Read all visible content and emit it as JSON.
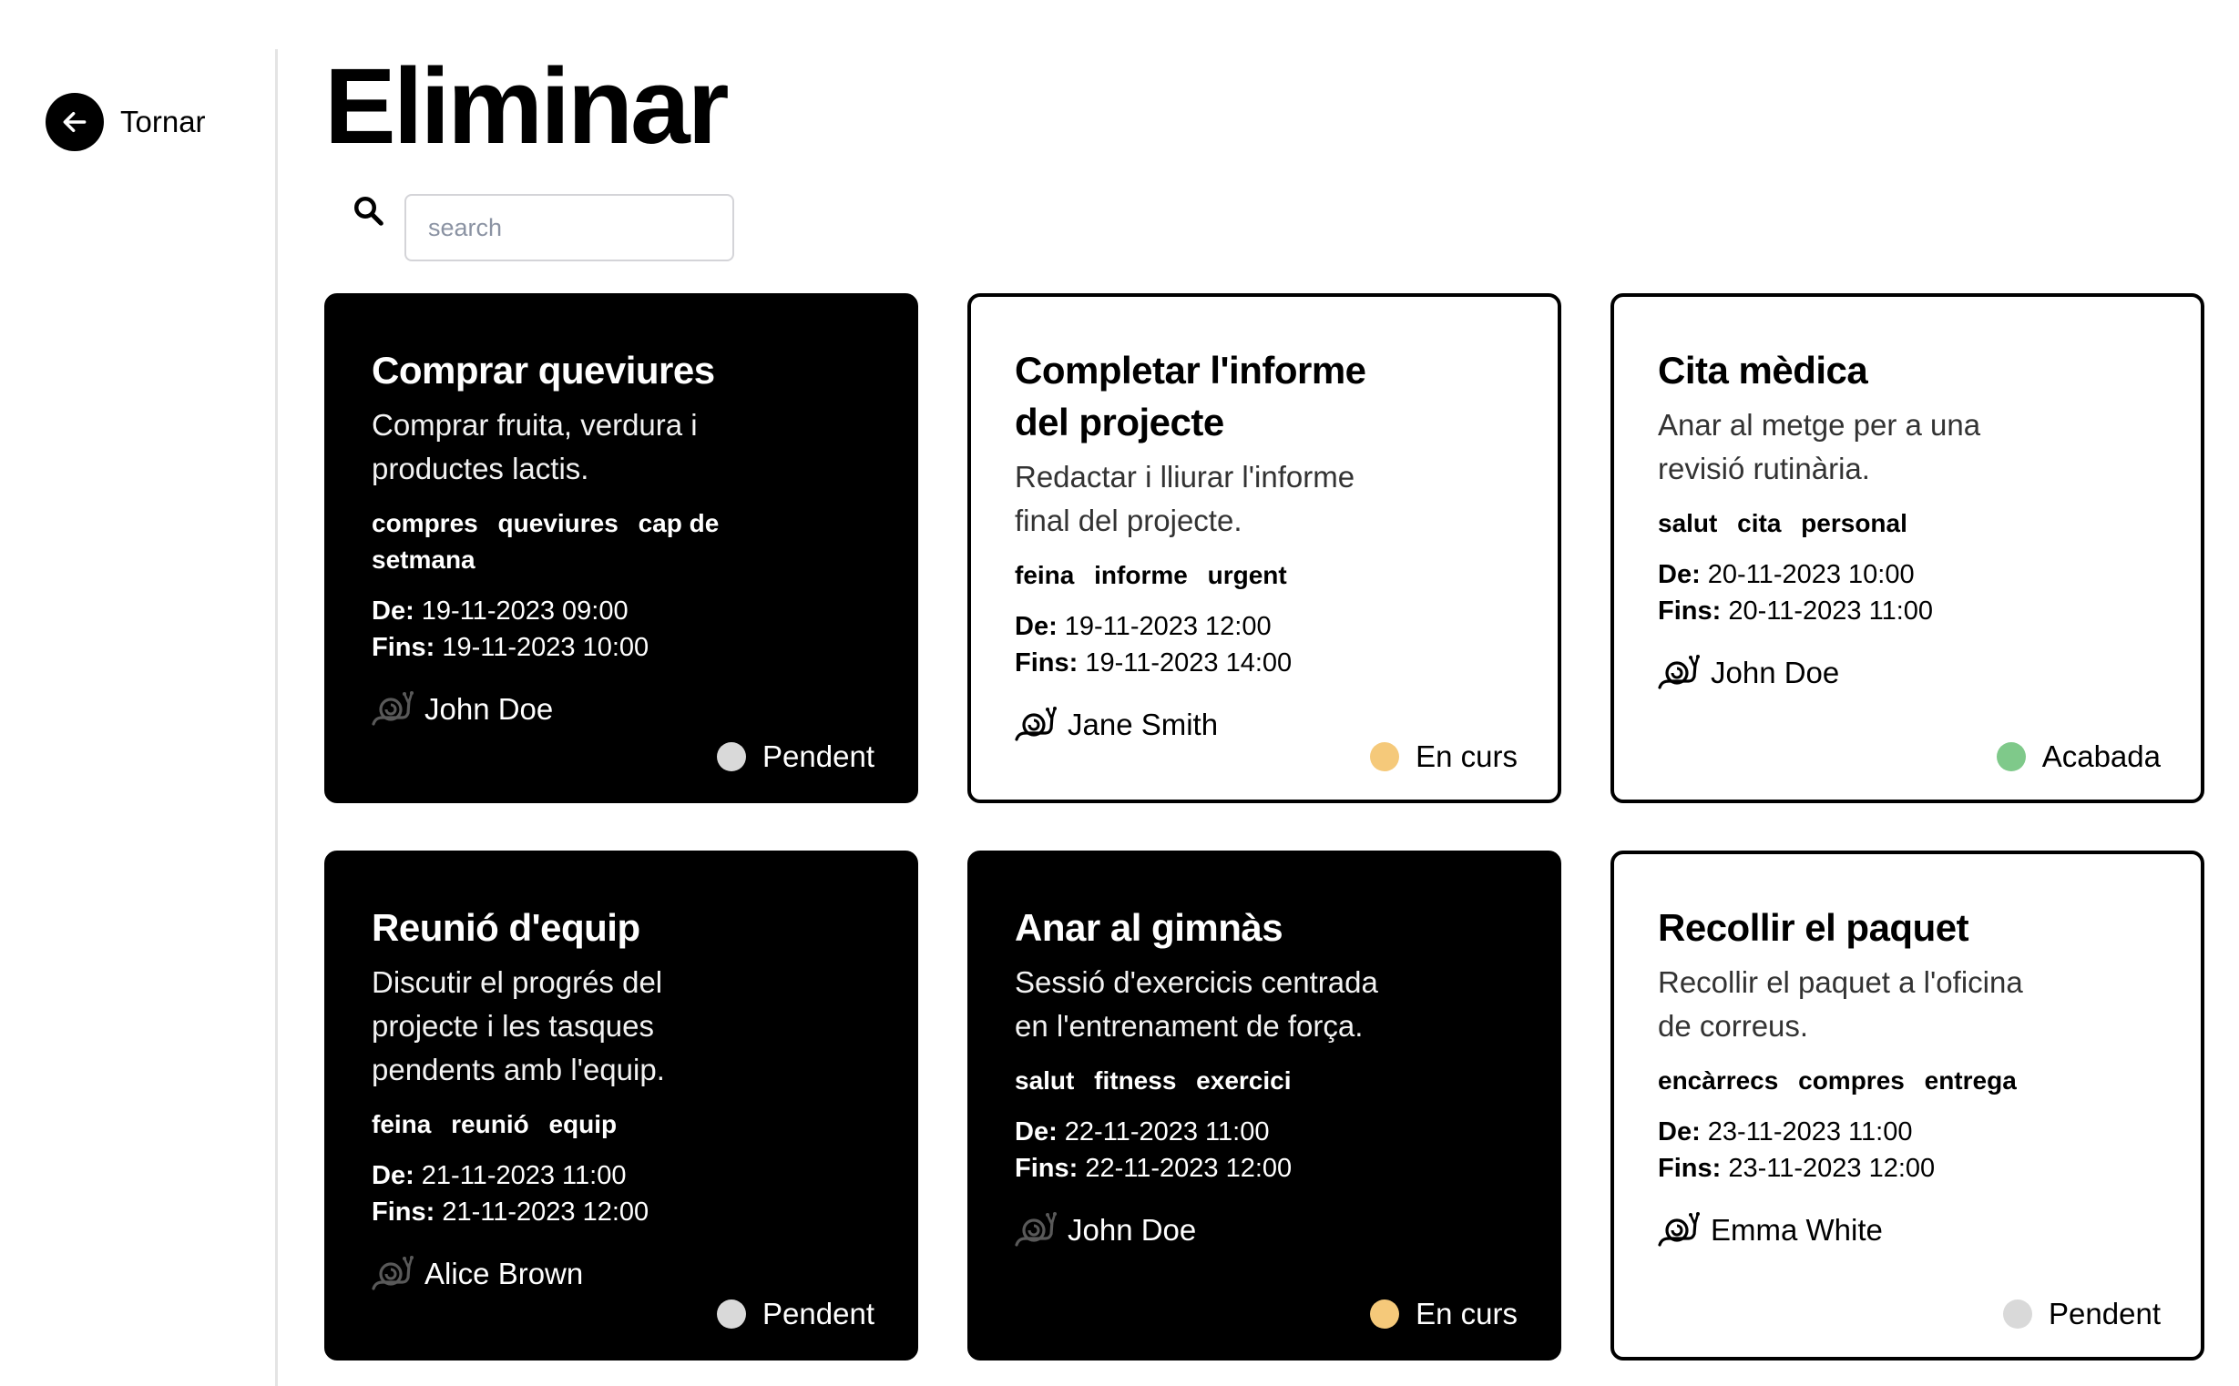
{
  "nav": {
    "back_label": "Tornar"
  },
  "page": {
    "title": "Eliminar"
  },
  "search": {
    "placeholder": "search"
  },
  "colors": {
    "pending": "#d9d9d9",
    "in_progress": "#f5c97a",
    "done": "#7fc98a"
  },
  "cards": [
    {
      "title": "Comprar queviures",
      "description": "Comprar fruita, verdura i productes lactis.",
      "tags": [
        "compres",
        "queviures",
        "cap de setmana"
      ],
      "from_label": "De:",
      "from": "19-11-2023 09:00",
      "to_label": "Fins:",
      "to": "19-11-2023 10:00",
      "owner": "John Doe",
      "status": "Pendent",
      "status_key": "pending"
    },
    {
      "title": "Completar l'informe del projecte",
      "description": "Redactar i lliurar l'informe final del projecte.",
      "tags": [
        "feina",
        "informe",
        "urgent"
      ],
      "from_label": "De:",
      "from": "19-11-2023 12:00",
      "to_label": "Fins:",
      "to": "19-11-2023 14:00",
      "owner": "Jane Smith",
      "status": "En curs",
      "status_key": "in_progress"
    },
    {
      "title": "Cita mèdica",
      "description": "Anar al metge per a una revisió rutinària.",
      "tags": [
        "salut",
        "cita",
        "personal"
      ],
      "from_label": "De:",
      "from": "20-11-2023 10:00",
      "to_label": "Fins:",
      "to": "20-11-2023 11:00",
      "owner": "John Doe",
      "status": "Acabada",
      "status_key": "done"
    },
    {
      "title": "Reunió d'equip",
      "description": "Discutir el progrés del projecte i les tasques pendents amb l'equip.",
      "tags": [
        "feina",
        "reunió",
        "equip"
      ],
      "from_label": "De:",
      "from": "21-11-2023 11:00",
      "to_label": "Fins:",
      "to": "21-11-2023 12:00",
      "owner": "Alice Brown",
      "status": "Pendent",
      "status_key": "pending"
    },
    {
      "title": "Anar al gimnàs",
      "description": "Sessió d'exercicis centrada en l'entrenament de força.",
      "tags": [
        "salut",
        "fitness",
        "exercici"
      ],
      "from_label": "De:",
      "from": "22-11-2023 11:00",
      "to_label": "Fins:",
      "to": "22-11-2023 12:00",
      "owner": "John Doe",
      "status": "En curs",
      "status_key": "in_progress"
    },
    {
      "title": "Recollir el paquet",
      "description": "Recollir el paquet a l'oficina de correus.",
      "tags": [
        "encàrrecs",
        "compres",
        "entrega"
      ],
      "from_label": "De:",
      "from": "23-11-2023 11:00",
      "to_label": "Fins:",
      "to": "23-11-2023 12:00",
      "owner": "Emma White",
      "status": "Pendent",
      "status_key": "pending"
    }
  ]
}
